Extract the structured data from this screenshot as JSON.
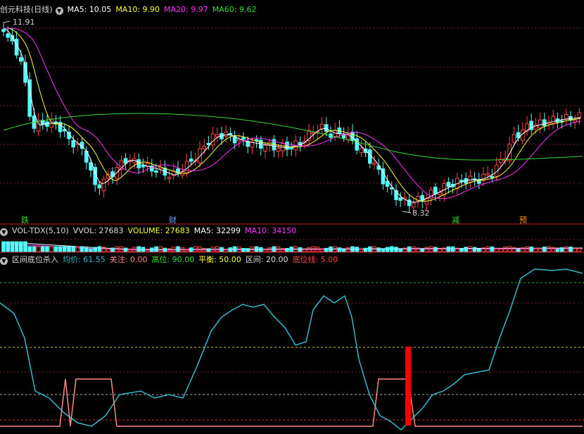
{
  "price_header": {
    "stock": "创元科技(日线)",
    "ma5": "MA5: 10.05",
    "ma10": "MA10: 9.90",
    "ma20": "MA20: 9.97",
    "ma60": "MA60: 9.62"
  },
  "price_labels": {
    "high": "11.91",
    "low": "8.32"
  },
  "event_markers": [
    {
      "label": "跌",
      "color": "#33dd33"
    },
    {
      "label": "财",
      "color": "#6fa8ff"
    },
    {
      "label": "减",
      "color": "#33dd33"
    },
    {
      "label": "预",
      "color": "#ff9900"
    }
  ],
  "volume_header": {
    "name": "VOL-TDX(5,10)",
    "vvol": "VVOL: 27683",
    "volume": "VOLUME: 27683",
    "ma5": "MA5: 32299",
    "ma10": "MA10: 34150"
  },
  "indicator_header": {
    "name": "区间底位杀入",
    "avg": "均价: 61.55",
    "focus": "关注: 0.00",
    "high": "高位: 90.00",
    "balance": "平衡: 50.00",
    "range": "区间: 20.00",
    "bottom": "底位线: 5.00"
  },
  "colors": {
    "up": "#ff4444",
    "down": "#54fcfc",
    "ma5": "#ffffff",
    "ma10": "#ffff33",
    "ma20": "#ff33ff",
    "ma60": "#33dd33",
    "avg": "#33bbcc",
    "signal": "#ff8888"
  }
}
